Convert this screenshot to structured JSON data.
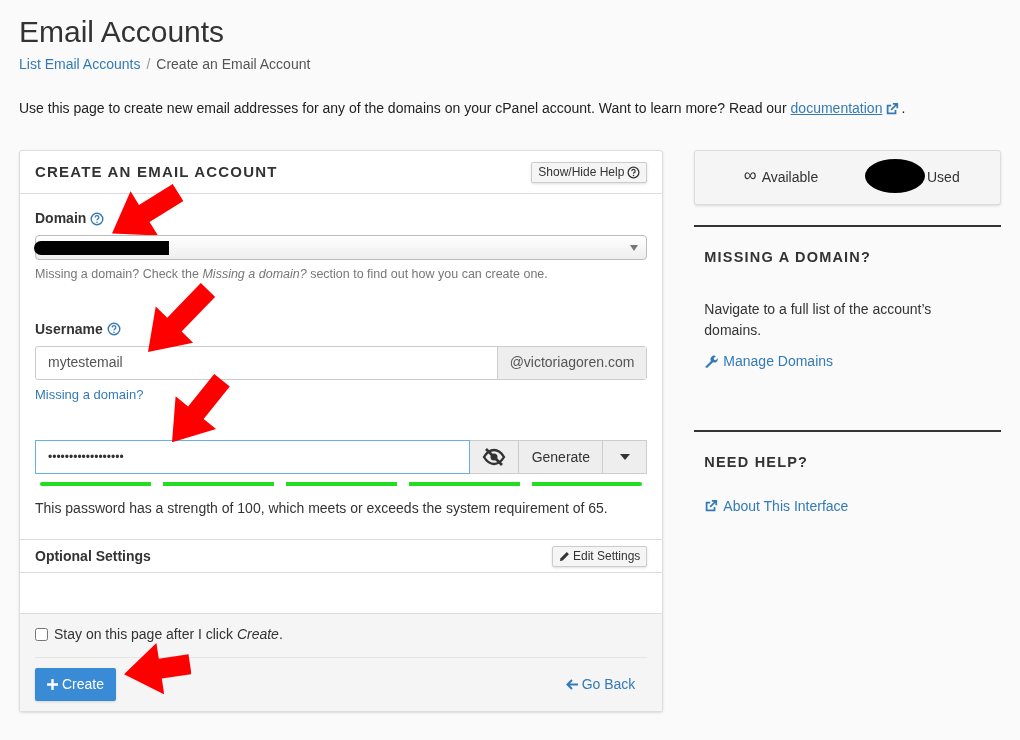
{
  "title": "Email Accounts",
  "breadcrumb_separator": "/",
  "breadcrumb": [
    {
      "label": "List Email Accounts",
      "link": true
    },
    {
      "label": "Create an Email Account",
      "link": false
    }
  ],
  "intro": {
    "text": "Use this page to create new email addresses for any of the domains on your cPanel account. Want to learn more? Read our",
    "link": "documentation",
    "end": "."
  },
  "form": {
    "heading": "CREATE AN EMAIL ACCOUNT",
    "help_button": "Show/Hide Help",
    "domain": {
      "label": "Domain",
      "hint": "Missing a domain? Check the *Missing a domain?* section to find out how you can create one."
    },
    "username": {
      "label": "Username",
      "value": "mytestemail",
      "suffix": "@victoriagoren.com",
      "link": "Missing a domain?"
    },
    "password": {
      "value": "••••••••••••••••••",
      "generate": "Generate",
      "strength": {
        "level": 1
      },
      "message": "This password has a strength of 100, which meets or exceeds the system requirement of 65."
    },
    "optional": {
      "heading": "Optional Settings",
      "button": "Edit Settings"
    },
    "stay": {
      "label": "Stay on this page after I click *Create*.",
      "checked": false
    },
    "create": "Create",
    "back": "Go Back"
  },
  "sidebar": {
    "stats": {
      "available_value": "∞",
      "available": "Available",
      "used": "Used"
    },
    "sections": [
      {
        "heading": "MISSING A DOMAIN?",
        "text": "Navigate to a full list of the account’s domains.",
        "link": "Manage Domains"
      },
      {
        "heading": "NEED HELP?",
        "link": "About This Interface"
      }
    ]
  }
}
